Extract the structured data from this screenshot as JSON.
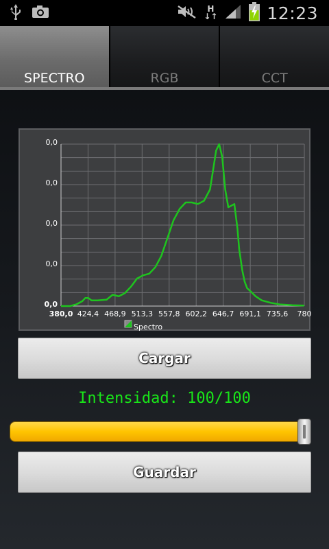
{
  "status_bar": {
    "time": "12:23",
    "network_type_top": "H",
    "network_type_bottom": "↓↑",
    "icons": [
      "usb-icon",
      "camera-icon",
      "mute-icon",
      "signal-icon",
      "battery-charging-icon"
    ]
  },
  "tabs": [
    {
      "label": "SPECTRO",
      "active": true
    },
    {
      "label": "RGB",
      "active": false
    },
    {
      "label": "CCT",
      "active": false
    }
  ],
  "chart_data": {
    "type": "line",
    "series": [
      {
        "name": "Spectro",
        "color": "#1ec41e"
      }
    ],
    "x_tick_labels": [
      "380,0",
      "424,4",
      "468,9",
      "513,3",
      "557,8",
      "602,2",
      "646,7",
      "691,1",
      "735,6",
      "780"
    ],
    "y_tick_labels": [
      "0,0",
      "0,0",
      "0,0",
      "0,0"
    ],
    "xlim": [
      380,
      780
    ],
    "ylim": [
      0,
      1
    ],
    "grid": true,
    "legend_position": "bottom",
    "x": [
      380,
      395,
      405,
      415,
      420,
      425,
      430,
      440,
      455,
      465,
      475,
      485,
      495,
      505,
      515,
      525,
      535,
      545,
      555,
      565,
      575,
      585,
      595,
      605,
      615,
      625,
      630,
      635,
      640,
      645,
      650,
      655,
      660,
      665,
      670,
      673,
      678,
      682,
      686,
      692,
      700,
      710,
      725,
      740,
      760,
      780
    ],
    "y": [
      0.0,
      0.0,
      0.01,
      0.03,
      0.05,
      0.05,
      0.035,
      0.035,
      0.04,
      0.07,
      0.06,
      0.08,
      0.12,
      0.17,
      0.19,
      0.2,
      0.24,
      0.31,
      0.42,
      0.53,
      0.6,
      0.64,
      0.64,
      0.63,
      0.65,
      0.72,
      0.84,
      0.96,
      1.0,
      0.92,
      0.72,
      0.61,
      0.62,
      0.63,
      0.48,
      0.35,
      0.22,
      0.15,
      0.11,
      0.09,
      0.06,
      0.035,
      0.02,
      0.01,
      0.005,
      0.003
    ]
  },
  "buttons": {
    "load": "Cargar",
    "save": "Guardar"
  },
  "intensity": {
    "text": "Intensidad: 100/100",
    "value": 100,
    "max": 100
  },
  "colors": {
    "line": "#1ec41e",
    "intensity_text": "#19e619",
    "slider_fill": "#ffc400"
  }
}
